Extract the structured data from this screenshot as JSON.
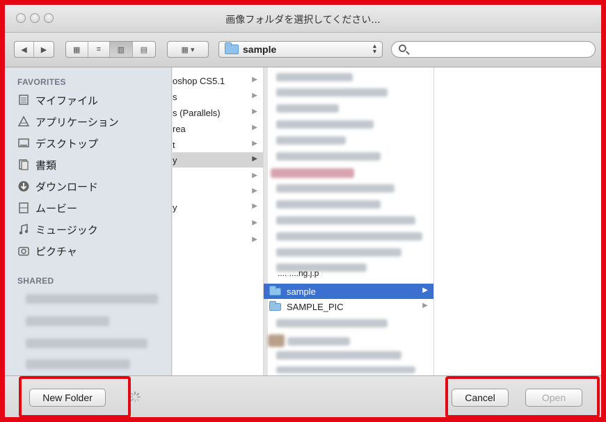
{
  "window": {
    "title": "画像フォルダを選択してください..."
  },
  "toolbar": {
    "path_label": "sample",
    "search_placeholder": ""
  },
  "sidebar": {
    "favorites_heading": "FAVORITES",
    "favorites": [
      {
        "label": "マイファイル",
        "icon": "all-my-files-icon"
      },
      {
        "label": "アプリケーション",
        "icon": "applications-icon"
      },
      {
        "label": "デスクトップ",
        "icon": "desktop-icon"
      },
      {
        "label": "書類",
        "icon": "documents-icon"
      },
      {
        "label": "ダウンロード",
        "icon": "downloads-icon"
      },
      {
        "label": "ムービー",
        "icon": "movies-icon"
      },
      {
        "label": "ミュージック",
        "icon": "music-icon"
      },
      {
        "label": "ピクチャ",
        "icon": "pictures-icon"
      }
    ],
    "shared_heading": "SHARED"
  },
  "column1": {
    "items": [
      {
        "label": "oshop CS5.1"
      },
      {
        "label": "s"
      },
      {
        "label": "s (Parallels)"
      },
      {
        "label": "rea"
      },
      {
        "label": "t"
      },
      {
        "label": "y"
      },
      {
        "label": ""
      },
      {
        "label": ""
      },
      {
        "label": "y"
      },
      {
        "label": ""
      },
      {
        "label": ""
      }
    ]
  },
  "column2": {
    "partial_item": "....  ....ng.j.p",
    "selected_item": "sample",
    "next_item": "SAMPLE_PIC"
  },
  "footer": {
    "new_folder_label": "New Folder",
    "cancel_label": "Cancel",
    "open_label": "Open"
  },
  "colors": {
    "highlight": "#e30613",
    "selection": "#3b6fd0"
  }
}
